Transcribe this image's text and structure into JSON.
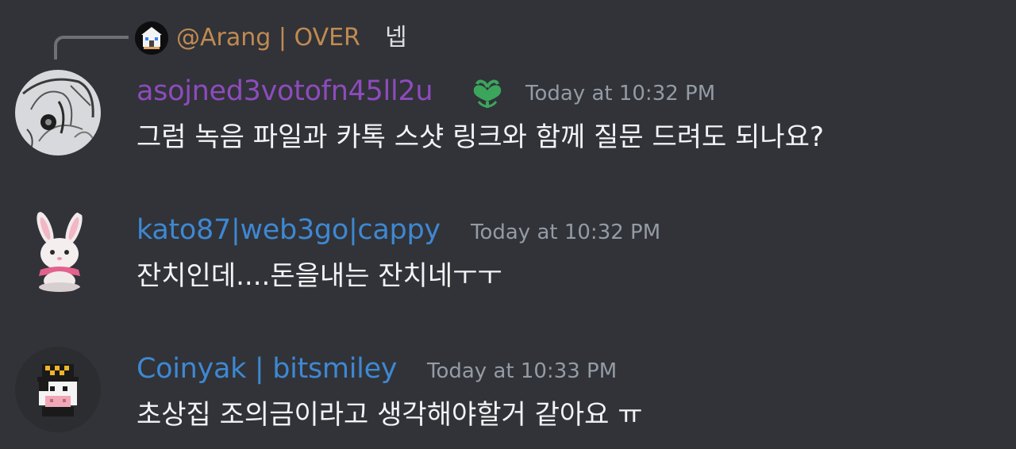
{
  "colors": {
    "background": "#313338",
    "reply_name": "#c08a52",
    "user1_name": "#8e4bbd",
    "user2_name": "#3e88d3",
    "user3_name": "#3e88d3",
    "timestamp": "#949ba4",
    "message_text": "#f2f3f5",
    "role_icon": "#3ba55c"
  },
  "reply": {
    "author": "@Arang | OVER",
    "text": "넵",
    "avatar_icon": "pixel-house-avatar"
  },
  "messages": [
    {
      "author": "asojned3votofn45ll2u",
      "role_icon": "clover-heart-icon",
      "timestamp": "Today at 10:32 PM",
      "text": "그럼 녹음 파일과 카톡 스샷 링크와 함께 질문 드려도 되나요?",
      "avatar_icon": "sketch-portrait-avatar"
    },
    {
      "author": "kato87|web3go|cappy",
      "timestamp": "Today at 10:32 PM",
      "text": "잔치인데....돈을내는 잔치네ㅜㅜ",
      "avatar_icon": "bunny-avatar"
    },
    {
      "author": "Coinyak | bitsmiley",
      "timestamp": "Today at 10:33 PM",
      "text": "초상집 조의금이라고 생각해야할거 같아요 ㅠ",
      "avatar_icon": "pixel-cow-avatar"
    }
  ]
}
